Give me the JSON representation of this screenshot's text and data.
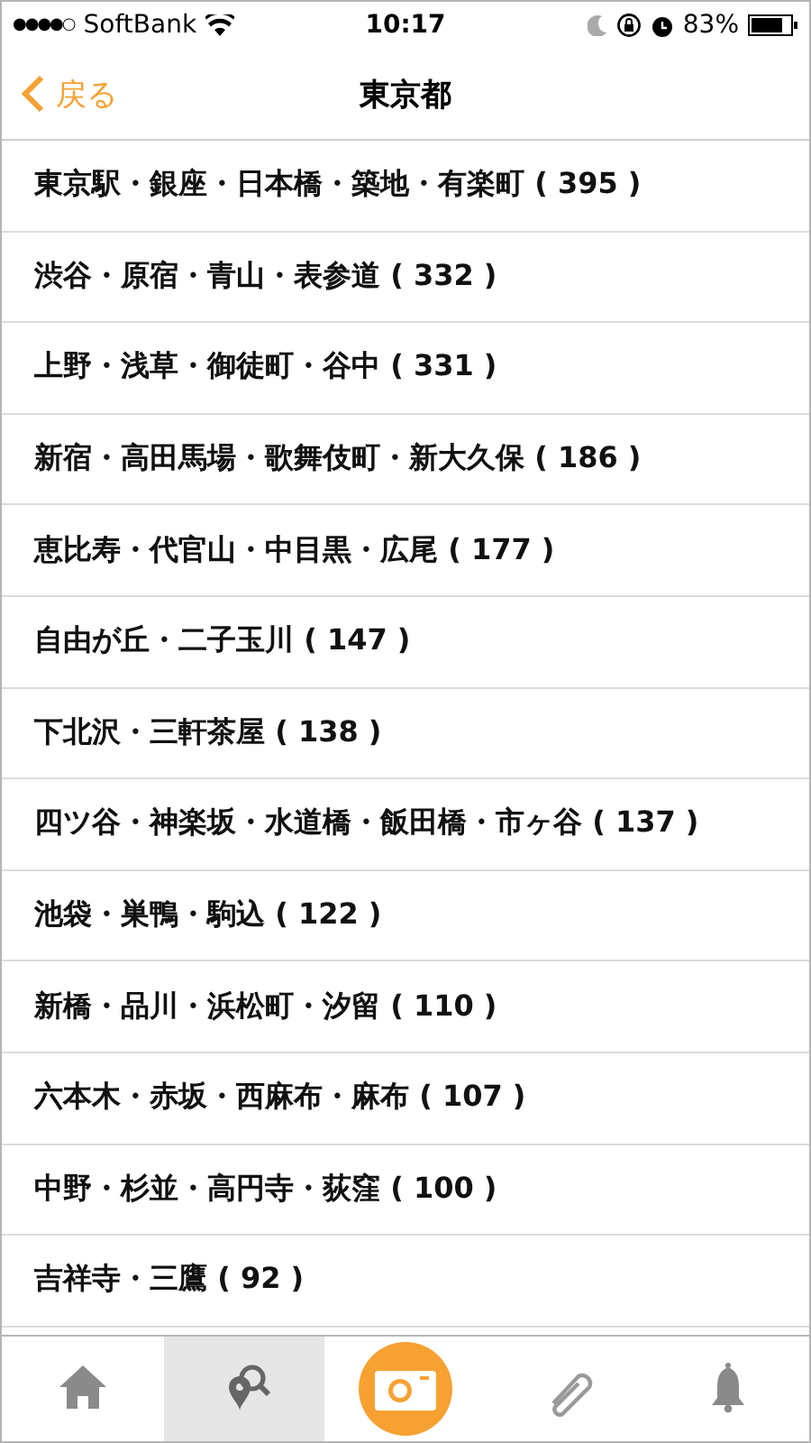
{
  "status_bar": {
    "carrier": "SoftBank",
    "signal_dots": "●●●●○",
    "time": "10:17",
    "battery": "83%"
  },
  "nav": {
    "back": "戻る",
    "title": "東京都"
  },
  "areas": [
    {
      "label": "東京駅・銀座・日本橋・築地・有楽町 ( 395 )"
    },
    {
      "label": "渋谷・原宿・青山・表参道 ( 332 )"
    },
    {
      "label": "上野・浅草・御徒町・谷中 ( 331 )"
    },
    {
      "label": "新宿・高田馬場・歌舞伎町・新大久保 ( 186 )"
    },
    {
      "label": "恵比寿・代官山・中目黒・広尾 ( 177 )"
    },
    {
      "label": "自由が丘・二子玉川 ( 147 )"
    },
    {
      "label": "下北沢・三軒茶屋 ( 138 )"
    },
    {
      "label": "四ツ谷・神楽坂・水道橋・飯田橋・市ヶ谷 ( 137 )"
    },
    {
      "label": "池袋・巣鴨・駒込 ( 122 )"
    },
    {
      "label": "新橋・品川・浜松町・汐留 ( 110 )"
    },
    {
      "label": "六本木・赤坂・西麻布・麻布 ( 107 )"
    },
    {
      "label": "中野・杉並・高円寺・荻窪 ( 100 )"
    },
    {
      "label": "吉祥寺・三鷹 ( 92 )"
    }
  ],
  "tab_bar": [
    {
      "kind": "home",
      "selected": false
    },
    {
      "kind": "search",
      "selected": true
    },
    {
      "kind": "camera",
      "selected": false
    },
    {
      "kind": "clip",
      "selected": false
    },
    {
      "kind": "bell",
      "selected": false
    }
  ]
}
